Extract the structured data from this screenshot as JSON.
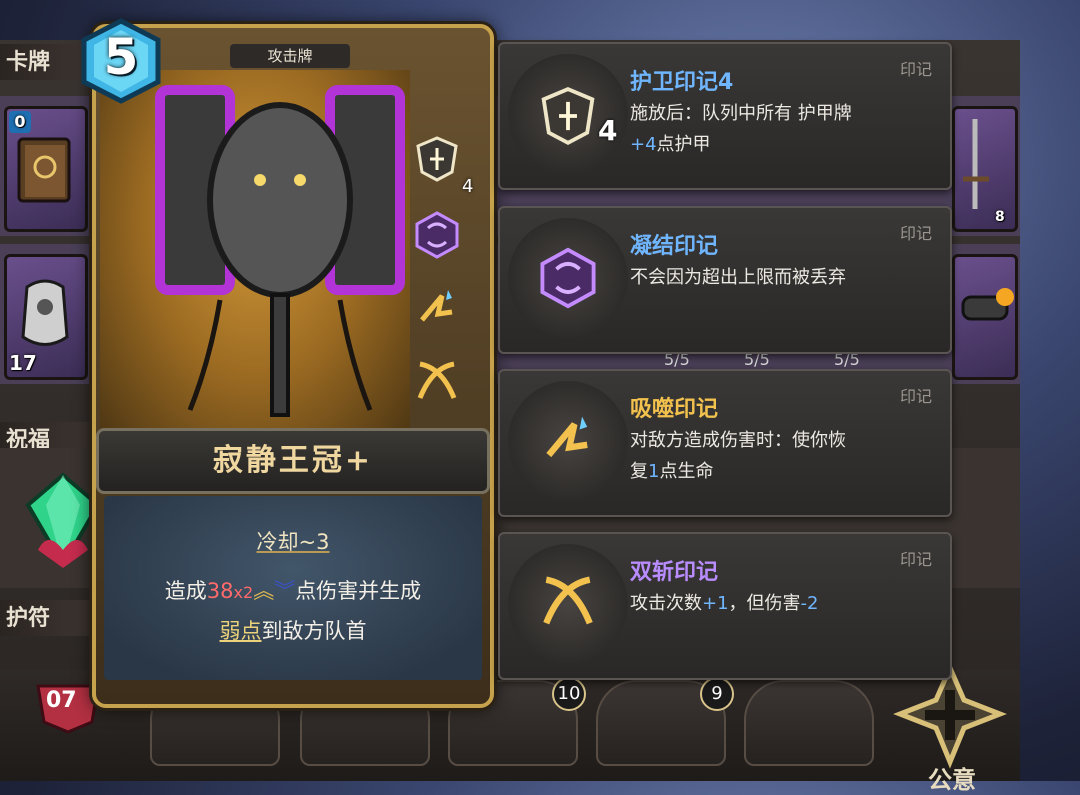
{
  "sections": {
    "cards": "卡牌",
    "blessing": "祝福",
    "amulet": "护符"
  },
  "mini_cards": [
    {
      "count": "0"
    },
    {
      "count": "17"
    }
  ],
  "right_counts": {
    "top": "8"
  },
  "stack_counters": [
    "5/5",
    "5/5",
    "5/5"
  ],
  "card": {
    "cost": "5",
    "type": "攻击牌",
    "title": "寂静王冠+",
    "cooldown": "冷却~3",
    "desc_prefix": "造成",
    "damage": "38",
    "multiplier": "x2",
    "desc_mid": "点伤害并生成",
    "keyword": "弱点",
    "desc_suffix": "到敌方队首",
    "sigil_count": "4"
  },
  "tooltips": [
    {
      "name": "护卫印记4",
      "tag": "印记",
      "count": "4",
      "desc_a": "施放后：队列中所有 护甲牌",
      "desc_b_hl": "+4",
      "desc_b": "点护甲",
      "name_color": "#6fb6ff"
    },
    {
      "name": "凝结印记",
      "tag": "印记",
      "desc_a": "不会因为超出上限而被丢弃",
      "name_color": "#6fb6ff"
    },
    {
      "name": "吸噬印记",
      "tag": "印记",
      "desc_a": "对敌方造成伤害时：使你恢",
      "desc_b_pre": "复",
      "desc_b_hl": "1",
      "desc_b": "点生命",
      "name_color": "#f2c14e"
    },
    {
      "name": "双斩印记",
      "tag": "印记",
      "desc_pre": "攻击次数",
      "hl1": "+1",
      "desc_mid": "，但伤害",
      "hl2": "-2",
      "name_color": "#b98cff"
    }
  ],
  "bottom_bar": {
    "level": "07",
    "slot_a": "10",
    "slot_b": "9",
    "corner": "公意"
  },
  "colors": {
    "accent_blue": "#6fb6ff",
    "accent_gold": "#f2c14e",
    "accent_purple": "#b98cff",
    "damage_red": "#ff6a6a"
  }
}
